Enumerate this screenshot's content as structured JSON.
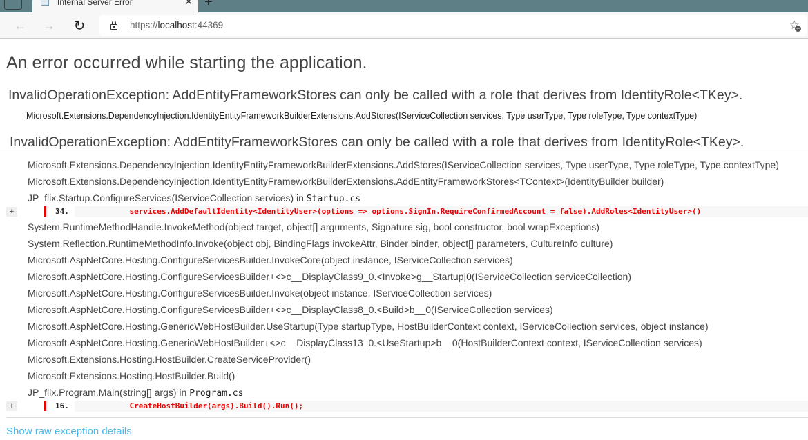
{
  "browser": {
    "tab_title": "Internal Server Error",
    "url_scheme": "https://",
    "url_host": "localhost",
    "url_port": ":44369",
    "icons": {
      "back": "←",
      "forward": "→",
      "reload": "↻",
      "favorite": "☆",
      "favorite_plus": "+",
      "tab_close": "✕",
      "new_tab": "+"
    }
  },
  "page": {
    "heading": "An error occurred while starting the application.",
    "exception_title": "InvalidOperationException: AddEntityFrameworkStores can only be called with a role that derives from IdentityRole<TKey>.",
    "exception_location": "Microsoft.Extensions.DependencyInjection.IdentityEntityFrameworkBuilderExtensions.AddStores(IServiceCollection services, Type userType, Type roleType, Type contextType)",
    "exception_title_2": "InvalidOperationException: AddEntityFrameworkStores can only be called with a role that derives from IdentityRole<TKey>.",
    "stack": [
      {
        "text": "Microsoft.Extensions.DependencyInjection.IdentityEntityFrameworkBuilderExtensions.AddStores(IServiceCollection services, Type userType, Type roleType, Type contextType)"
      },
      {
        "text": "Microsoft.Extensions.DependencyInjection.IdentityEntityFrameworkBuilderExtensions.AddEntityFrameworkStores<TContext>(IdentityBuilder builder)"
      },
      {
        "text": "JP_flix.Startup.ConfigureServices(IServiceCollection services) in ",
        "file": "Startup.cs"
      },
      {
        "expand": "+",
        "line": "34.",
        "code": "            services.AddDefaultIdentity<IdentityUser>(options => options.SignIn.RequireConfirmedAccount = false).AddRoles<IdentityUser>()"
      },
      {
        "text": "System.RuntimeMethodHandle.InvokeMethod(object target, object[] arguments, Signature sig, bool constructor, bool wrapExceptions)"
      },
      {
        "text": "System.Reflection.RuntimeMethodInfo.Invoke(object obj, BindingFlags invokeAttr, Binder binder, object[] parameters, CultureInfo culture)"
      },
      {
        "text": "Microsoft.AspNetCore.Hosting.ConfigureServicesBuilder.InvokeCore(object instance, IServiceCollection services)"
      },
      {
        "text": "Microsoft.AspNetCore.Hosting.ConfigureServicesBuilder+<>c__DisplayClass9_0.<Invoke>g__Startup|0(IServiceCollection serviceCollection)"
      },
      {
        "text": "Microsoft.AspNetCore.Hosting.ConfigureServicesBuilder.Invoke(object instance, IServiceCollection services)"
      },
      {
        "text": "Microsoft.AspNetCore.Hosting.ConfigureServicesBuilder+<>c__DisplayClass8_0.<Build>b__0(IServiceCollection services)"
      },
      {
        "text": "Microsoft.AspNetCore.Hosting.GenericWebHostBuilder.UseStartup(Type startupType, HostBuilderContext context, IServiceCollection services, object instance)"
      },
      {
        "text": "Microsoft.AspNetCore.Hosting.GenericWebHostBuilder+<>c__DisplayClass13_0.<UseStartup>b__0(HostBuilderContext context, IServiceCollection services)"
      },
      {
        "text": "Microsoft.Extensions.Hosting.HostBuilder.CreateServiceProvider()"
      },
      {
        "text": "Microsoft.Extensions.Hosting.HostBuilder.Build()"
      },
      {
        "text": "JP_flix.Program.Main(string[] args) in ",
        "file": "Program.cs"
      },
      {
        "expand": "+",
        "line": "16.",
        "code": "            CreateHostBuilder(args).Build().Run();"
      }
    ],
    "raw_link": "Show raw exception details"
  }
}
